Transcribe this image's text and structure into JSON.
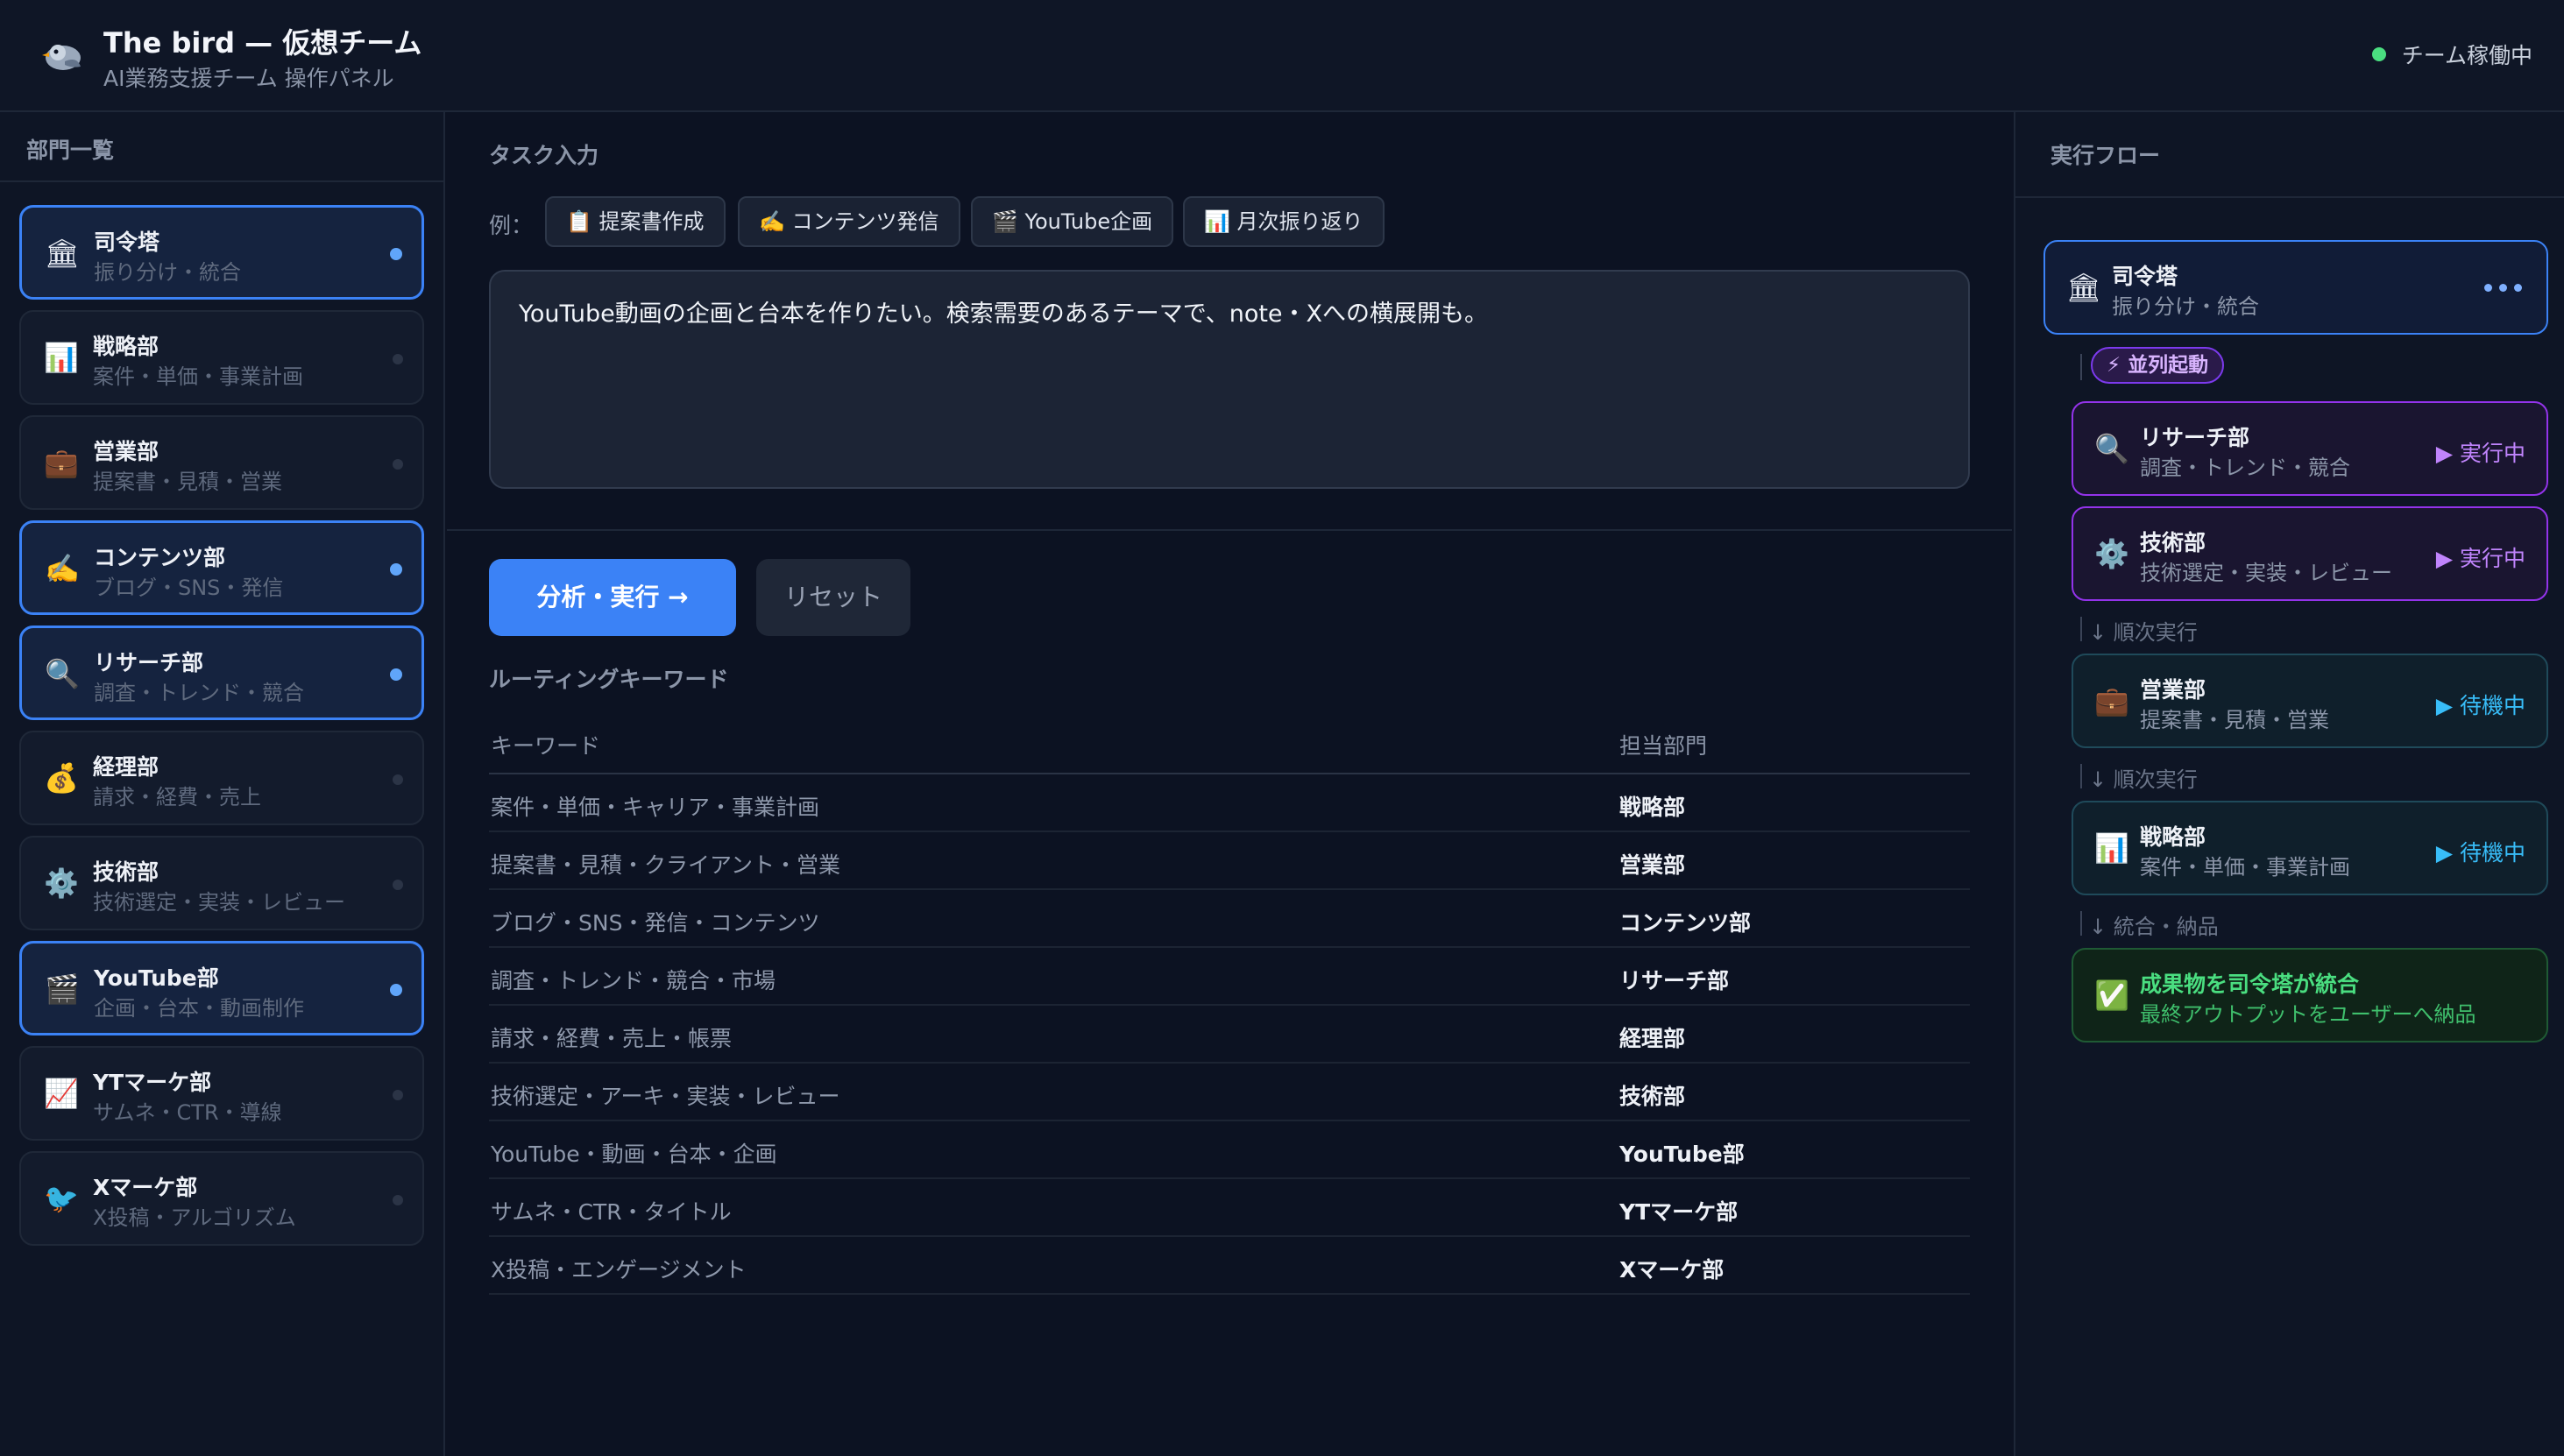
{
  "header": {
    "title": "The bird — 仮想チーム",
    "subtitle": "AI業務支援チーム 操作パネル",
    "status": "チーム稼働中",
    "logo_icon": "bird-icon"
  },
  "sidebar": {
    "heading": "部門一覧",
    "items": [
      {
        "icon": "🏛",
        "name": "司令塔",
        "desc": "振り分け・統合",
        "active": true
      },
      {
        "icon": "📊",
        "name": "戦略部",
        "desc": "案件・単価・事業計画",
        "active": false
      },
      {
        "icon": "💼",
        "name": "営業部",
        "desc": "提案書・見積・営業",
        "active": false
      },
      {
        "icon": "✍️",
        "name": "コンテンツ部",
        "desc": "ブログ・SNS・発信",
        "active": true
      },
      {
        "icon": "🔍",
        "name": "リサーチ部",
        "desc": "調査・トレンド・競合",
        "active": true
      },
      {
        "icon": "💰",
        "name": "経理部",
        "desc": "請求・経費・売上",
        "active": false
      },
      {
        "icon": "⚙️",
        "name": "技術部",
        "desc": "技術選定・実装・レビュー",
        "active": false
      },
      {
        "icon": "🎬",
        "name": "YouTube部",
        "desc": "企画・台本・動画制作",
        "active": true
      },
      {
        "icon": "📈",
        "name": "YTマーケ部",
        "desc": "サムネ・CTR・導線",
        "active": false
      },
      {
        "icon": "🐦",
        "name": "Xマーケ部",
        "desc": "X投稿・アルゴリズム",
        "active": false
      }
    ]
  },
  "main": {
    "task_heading": "タスク入力",
    "examples_label": "例：",
    "examples": [
      "📋 提案書作成",
      "✍️ コンテンツ発信",
      "🎬 YouTube企画",
      "📊 月次振り返り"
    ],
    "task_text": "YouTube動画の企画と台本を作りたい。検索需要のあるテーマで、note・Xへの横展開も。",
    "run_button": "分析・実行 →",
    "reset_button": "リセット",
    "routing_heading": "ルーティングキーワード",
    "table_headers": [
      "キーワード",
      "担当部門"
    ],
    "routing": [
      {
        "keywords": "案件・単価・キャリア・事業計画",
        "dept": "戦略部"
      },
      {
        "keywords": "提案書・見積・クライアント・営業",
        "dept": "営業部"
      },
      {
        "keywords": "ブログ・SNS・発信・コンテンツ",
        "dept": "コンテンツ部"
      },
      {
        "keywords": "調査・トレンド・競合・市場",
        "dept": "リサーチ部"
      },
      {
        "keywords": "請求・経費・売上・帳票",
        "dept": "経理部"
      },
      {
        "keywords": "技術選定・アーキ・実装・レビュー",
        "dept": "技術部"
      },
      {
        "keywords": "YouTube・動画・台本・企画",
        "dept": "YouTube部"
      },
      {
        "keywords": "サムネ・CTR・タイトル",
        "dept": "YTマーケ部"
      },
      {
        "keywords": "X投稿・エンゲージメント",
        "dept": "Xマーケ部"
      }
    ]
  },
  "flow": {
    "heading": "実行フロー",
    "command": {
      "icon": "🏛",
      "name": "司令塔",
      "desc": "振り分け・統合"
    },
    "parallel_badge": "⚡ 並列起動",
    "parallel": [
      {
        "icon": "🔍",
        "name": "リサーチ部",
        "desc": "調査・トレンド・競合",
        "status": "▶ 実行中"
      },
      {
        "icon": "⚙️",
        "name": "技術部",
        "desc": "技術選定・実装・レビュー",
        "status": "▶ 実行中"
      }
    ],
    "seq_label_1": "↓ 順次実行",
    "seq1": {
      "icon": "💼",
      "name": "営業部",
      "desc": "提案書・見積・営業",
      "status": "▶ 待機中"
    },
    "seq_label_2": "↓ 順次実行",
    "seq2": {
      "icon": "📊",
      "name": "戦略部",
      "desc": "案件・単価・事業計画",
      "status": "▶ 待機中"
    },
    "merge_label": "↓ 統合・納品",
    "final": {
      "icon": "✅",
      "name": "成果物を司令塔が統合",
      "desc": "最終アウトプットをユーザーへ納品"
    }
  }
}
